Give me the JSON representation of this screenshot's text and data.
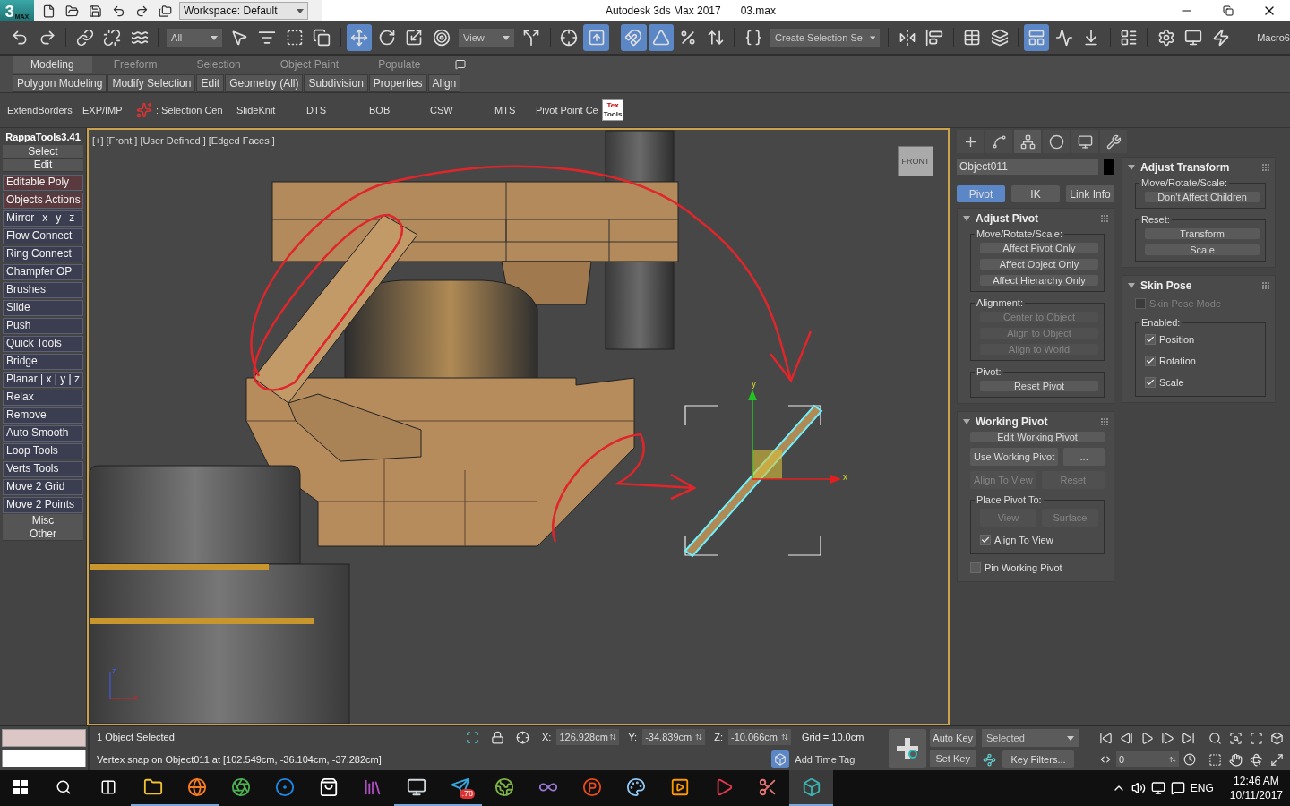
{
  "title_bar": {
    "logo": {
      "mark": "3",
      "sub": "MAX"
    },
    "workspace": "Workspace: Default",
    "title": "Autodesk 3ds Max 2017",
    "file": "03.max"
  },
  "main_toolbar": {
    "groups": [
      [
        {
          "kind": "icon",
          "selected": false
        },
        {
          "kind": "icon",
          "selected": false
        }
      ],
      [
        {
          "kind": "icon",
          "selected": false
        },
        {
          "kind": "icon",
          "selected": false
        },
        {
          "kind": "icon",
          "selected": false
        }
      ],
      [
        {
          "kind": "dropdown",
          "value": "All"
        },
        {
          "kind": "icon",
          "selected": false
        },
        {
          "kind": "icon",
          "selected": false
        },
        {
          "kind": "icon",
          "selected": false
        },
        {
          "kind": "icon",
          "selected": false
        }
      ],
      [
        {
          "kind": "icon",
          "selected": true
        },
        {
          "kind": "icon",
          "selected": false
        },
        {
          "kind": "icon",
          "selected": false
        },
        {
          "kind": "icon",
          "selected": false
        },
        {
          "kind": "dropdown",
          "value": "View"
        },
        {
          "kind": "icon",
          "selected": false
        }
      ],
      [
        {
          "kind": "icon",
          "selected": false
        },
        {
          "kind": "icon",
          "selected": true
        }
      ],
      [
        {
          "kind": "icon",
          "selected": true
        },
        {
          "kind": "icon",
          "selected": true
        },
        {
          "kind": "icon",
          "selected": false
        },
        {
          "kind": "icon",
          "selected": false
        }
      ],
      [
        {
          "kind": "icon",
          "selected": false
        },
        {
          "kind": "dropdown",
          "value": "Create Selection Se"
        }
      ],
      [
        {
          "kind": "icon",
          "selected": false
        },
        {
          "kind": "icon",
          "selected": false
        }
      ],
      [
        {
          "kind": "icon",
          "selected": false
        },
        {
          "kind": "icon",
          "selected": false
        }
      ],
      [
        {
          "kind": "icon",
          "selected": true
        },
        {
          "kind": "icon",
          "selected": false
        },
        {
          "kind": "icon",
          "selected": false
        }
      ],
      [
        {
          "kind": "icon",
          "selected": false
        }
      ],
      [
        {
          "kind": "icon",
          "selected": false
        },
        {
          "kind": "icon",
          "selected": false
        },
        {
          "kind": "icon",
          "selected": false
        },
        {
          "kind": "label",
          "text": "Macro6"
        }
      ]
    ]
  },
  "ribbon": {
    "tabs": [
      {
        "label": "Modeling",
        "selected": true
      },
      {
        "label": "Freeform",
        "selected": false
      },
      {
        "label": "Selection",
        "selected": false
      },
      {
        "label": "Object Paint",
        "selected": false
      },
      {
        "label": "Populate",
        "selected": false
      }
    ],
    "panels": [
      "Polygon Modeling",
      "Modify Selection",
      "Edit",
      "Geometry (All)",
      "Subdivision",
      "Properties",
      "Align"
    ]
  },
  "custom_toolbar": {
    "items": [
      {
        "kind": "text",
        "label": "ExtendBorders"
      },
      {
        "kind": "text",
        "label": "EXP/IMP"
      },
      {
        "kind": "icon-text",
        "label": ": Selection Cen"
      },
      {
        "kind": "text",
        "label": "SlideKnit"
      },
      {
        "kind": "text",
        "label": "DTS"
      },
      {
        "kind": "text",
        "label": "BOB"
      },
      {
        "kind": "text",
        "label": "CSW"
      },
      {
        "kind": "text",
        "label": "MTS"
      },
      {
        "kind": "text",
        "label": "Pivot Point Ce"
      },
      {
        "kind": "logo",
        "label": "Tex",
        "sub": "Tools"
      }
    ]
  },
  "rappa_tools": {
    "title": "RappaTools3.41",
    "top_sections": [
      "Select",
      "Edit"
    ],
    "tools": [
      {
        "label": "Editable Poly",
        "highlighted": true
      },
      {
        "label": "Objects Actions",
        "highlighted": true
      },
      {
        "label": "Mirror",
        "axes": [
          "x",
          "y",
          "z"
        ],
        "highlighted": false
      },
      {
        "label": "Flow Connect",
        "highlighted": false
      },
      {
        "label": "Ring Connect",
        "highlighted": false
      },
      {
        "label": "Champfer OP",
        "highlighted": false
      },
      {
        "label": "Brushes",
        "highlighted": false
      },
      {
        "label": "Slide",
        "highlighted": false
      },
      {
        "label": "Push",
        "highlighted": false
      },
      {
        "label": "Quick Tools",
        "highlighted": false
      },
      {
        "label": "Bridge",
        "highlighted": false
      },
      {
        "label": "Planar | x | y | z",
        "highlighted": false
      },
      {
        "label": "Relax",
        "highlighted": false
      },
      {
        "label": "Remove",
        "highlighted": false
      },
      {
        "label": "Auto Smooth",
        "highlighted": false
      },
      {
        "label": "Loop Tools",
        "highlighted": false
      },
      {
        "label": "Verts Tools",
        "highlighted": false
      },
      {
        "label": "Move 2 Grid",
        "highlighted": false
      },
      {
        "label": "Move 2 Points",
        "highlighted": false
      }
    ],
    "bottom_sections": [
      "Misc",
      "Other"
    ]
  },
  "viewport": {
    "active": true,
    "menus": [
      "[+]",
      "[Front ]",
      "[User Defined ]",
      "[Edged Faces ]"
    ],
    "viewcube": "FRONT",
    "gizmo_labels": [
      "y",
      "x"
    ],
    "tripod_labels": [
      "z",
      "x"
    ]
  },
  "command_panel": {
    "tabs": [
      {
        "selected": false
      },
      {
        "selected": false
      },
      {
        "selected": true
      },
      {
        "selected": false
      },
      {
        "selected": false
      },
      {
        "selected": false
      }
    ],
    "object_name": "Object011",
    "modes": [
      {
        "label": "Pivot",
        "selected": true
      },
      {
        "label": "IK",
        "selected": false
      },
      {
        "label": "Link Info",
        "selected": false
      }
    ],
    "left_rollouts": [
      {
        "title": "Adjust Pivot",
        "expanded": true,
        "items": [
          {
            "kind": "group",
            "label": "Move/Rotate/Scale:",
            "items": [
              {
                "kind": "button",
                "label": "Affect Pivot Only",
                "disabled": false
              },
              {
                "kind": "button",
                "label": "Affect Object Only",
                "disabled": false
              },
              {
                "kind": "button",
                "label": "Affect Hierarchy Only",
                "disabled": false
              }
            ]
          },
          {
            "kind": "group",
            "label": "Alignment:",
            "items": [
              {
                "kind": "button",
                "label": "Center to Object",
                "disabled": true
              },
              {
                "kind": "button",
                "label": "Align to Object",
                "disabled": true
              },
              {
                "kind": "button",
                "label": "Align to World",
                "disabled": true
              }
            ]
          },
          {
            "kind": "group",
            "label": "Pivot:",
            "items": [
              {
                "kind": "button",
                "label": "Reset Pivot",
                "disabled": false
              }
            ]
          }
        ]
      },
      {
        "title": "Working Pivot",
        "expanded": true,
        "items": [
          {
            "kind": "button",
            "label": "Edit Working Pivot",
            "disabled": false
          },
          {
            "kind": "row",
            "items": [
              {
                "kind": "button",
                "label": "Use Working Pivot",
                "disabled": false
              },
              {
                "kind": "button",
                "label": "...",
                "disabled": false
              }
            ]
          },
          {
            "kind": "row",
            "items": [
              {
                "kind": "button",
                "label": "Align To View",
                "disabled": true
              },
              {
                "kind": "button",
                "label": "Reset",
                "disabled": true
              }
            ]
          },
          {
            "kind": "group",
            "label": "Place Pivot To:",
            "items": [
              {
                "kind": "row",
                "items": [
                  {
                    "kind": "button",
                    "label": "View",
                    "disabled": true
                  },
                  {
                    "kind": "button",
                    "label": "Surface",
                    "disabled": true
                  }
                ]
              },
              {
                "kind": "checkbox",
                "label": "Align To View",
                "checked": true,
                "disabled": false
              }
            ]
          },
          {
            "kind": "checkbox",
            "label": "Pin Working Pivot",
            "checked": false,
            "disabled": false
          }
        ]
      }
    ],
    "right_rollouts": [
      {
        "title": "Adjust Transform",
        "expanded": true,
        "items": [
          {
            "kind": "group",
            "label": "Move/Rotate/Scale:",
            "items": [
              {
                "kind": "button",
                "label": "Don't Affect Children",
                "disabled": false
              }
            ]
          },
          {
            "kind": "group",
            "label": "Reset:",
            "items": [
              {
                "kind": "button",
                "label": "Transform",
                "disabled": false
              },
              {
                "kind": "button",
                "label": "Scale",
                "disabled": false
              }
            ]
          }
        ]
      },
      {
        "title": "Skin Pose",
        "expanded": true,
        "items": [
          {
            "kind": "checkbox",
            "label": "Skin Pose Mode",
            "checked": false,
            "disabled": true
          },
          {
            "kind": "group",
            "label": "Enabled:",
            "items": [
              {
                "kind": "checkbox",
                "label": "Position",
                "checked": true,
                "disabled": false
              },
              {
                "kind": "checkbox",
                "label": "Rotation",
                "checked": true,
                "disabled": false
              },
              {
                "kind": "checkbox",
                "label": "Scale",
                "checked": true,
                "disabled": false
              }
            ]
          }
        ]
      }
    ]
  },
  "status_bar": {
    "selection": "1 Object Selected",
    "prompt": "Vertex snap on Object011 at [102.549cm, -36.104cm, -37.282cm]",
    "coords": [
      {
        "axis": "X:",
        "value": "126.928cm"
      },
      {
        "axis": "Y:",
        "value": "-34.839cm"
      },
      {
        "axis": "Z:",
        "value": "-10.066cm"
      }
    ],
    "grid": "Grid = 10.0cm",
    "time_tag": "Add Time Tag",
    "auto_key": "Auto Key",
    "set_key": "Set Key",
    "key_mode": "Selected",
    "key_filters": "Key Filters...",
    "frame": "0"
  },
  "taskbar": {
    "apps": [
      {
        "running": true,
        "selected": false
      },
      {
        "running": true,
        "selected": false
      },
      {
        "running": false,
        "selected": false
      },
      {
        "running": false,
        "selected": false
      },
      {
        "running": false,
        "selected": false
      },
      {
        "running": false,
        "selected": false
      },
      {
        "running": true,
        "selected": false
      },
      {
        "running": true,
        "selected": false,
        "badge": ".78"
      },
      {
        "running": false,
        "selected": false
      },
      {
        "running": false,
        "selected": false
      },
      {
        "running": false,
        "selected": false
      },
      {
        "running": false,
        "selected": false
      },
      {
        "running": false,
        "selected": false
      },
      {
        "running": false,
        "selected": false
      },
      {
        "running": false,
        "selected": false
      },
      {
        "running": true,
        "selected": true
      }
    ],
    "language": "ENG",
    "time": "12:46 AM",
    "date": "10/11/2017"
  }
}
